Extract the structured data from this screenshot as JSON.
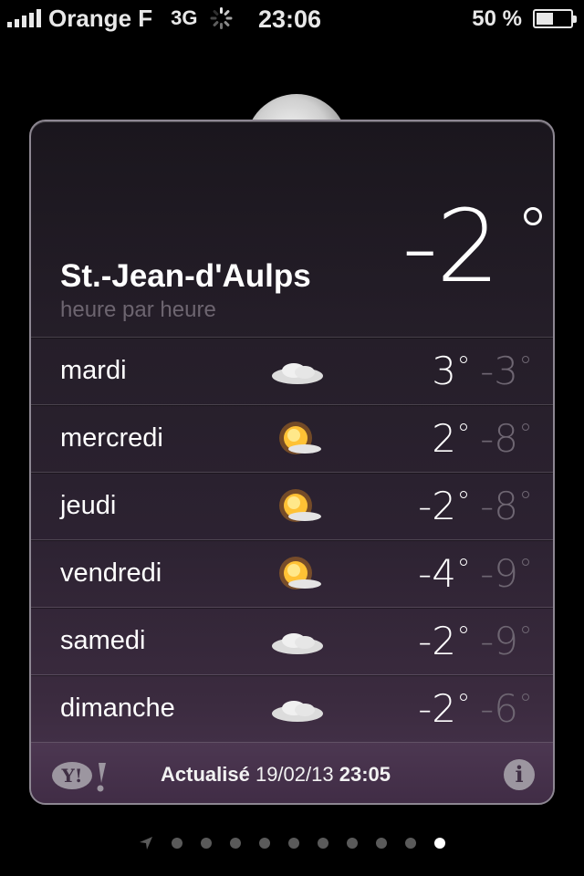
{
  "status_bar": {
    "carrier": "Orange F",
    "network": "3G",
    "time": "23:06",
    "battery_percent": "50 %"
  },
  "weather": {
    "city": "St.-Jean-d'Aulps",
    "subtitle": "heure par heure",
    "current_temp": "-2",
    "current_condition_icon": "moon-cloud-icon",
    "forecast": [
      {
        "day": "mardi",
        "icon": "cloud-icon",
        "high": "3",
        "low": "-3"
      },
      {
        "day": "mercredi",
        "icon": "sun-cloud-icon",
        "high": "2",
        "low": "-8"
      },
      {
        "day": "jeudi",
        "icon": "sun-cloud-icon",
        "high": "-2",
        "low": "-8"
      },
      {
        "day": "vendredi",
        "icon": "sun-cloud-icon",
        "high": "-4",
        "low": "-9"
      },
      {
        "day": "samedi",
        "icon": "cloud-icon",
        "high": "-2",
        "low": "-9"
      },
      {
        "day": "dimanche",
        "icon": "cloud-icon",
        "high": "-2",
        "low": "-6"
      }
    ],
    "footer": {
      "provider_logo": "Y!",
      "updated_label": "Actualisé",
      "updated_date": "19/02/13",
      "updated_time": "23:05",
      "info_label": "i"
    }
  },
  "pager": {
    "page_count": 10,
    "active_page": 10
  },
  "colors": {
    "card_top": "#1a161d",
    "card_bottom": "#4a3550",
    "low_temp": "#6e6672",
    "subtitle": "#6d6570"
  }
}
